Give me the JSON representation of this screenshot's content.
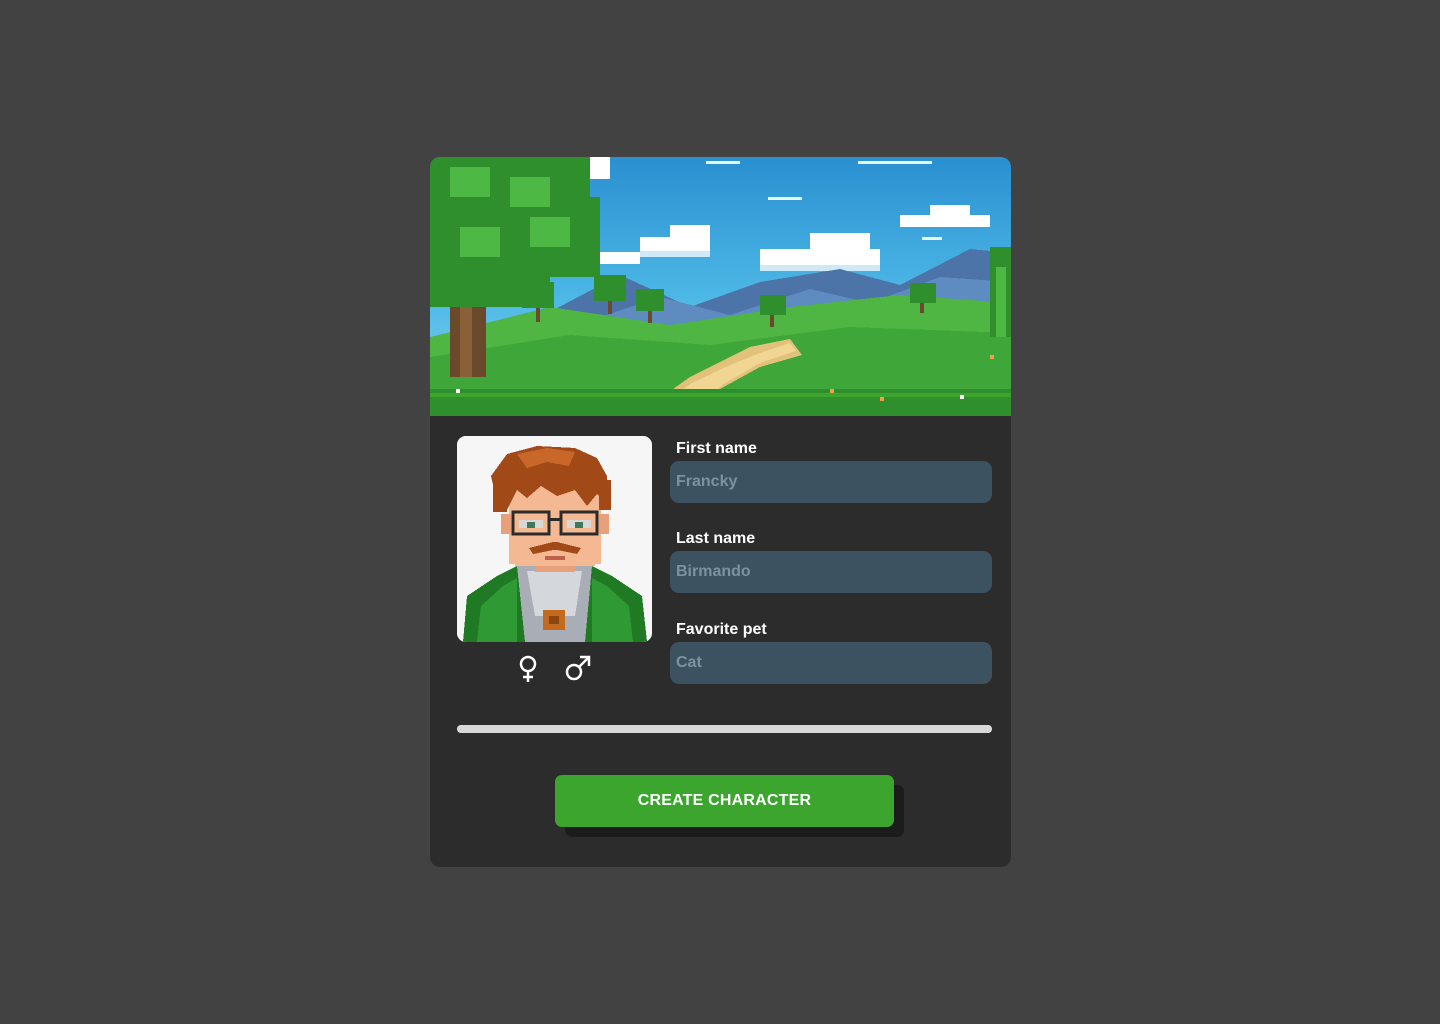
{
  "form": {
    "first_name": {
      "label": "First name",
      "placeholder": "Francky"
    },
    "last_name": {
      "label": "Last name",
      "placeholder": "Birmando"
    },
    "favorite_pet": {
      "label": "Favorite pet",
      "placeholder": "Cat"
    }
  },
  "gender_options": [
    "female-symbol-icon",
    "male-symbol-icon"
  ],
  "progress": {
    "fraction": 1.0
  },
  "create_button": {
    "label": "CREATE CHARACTER"
  },
  "colors": {
    "page_background": "#424242",
    "card_background": "#2c2c2c",
    "input_background": "#3c5261",
    "input_placeholder": "#7d92a0",
    "button_green": "#3ba52e",
    "progress": "#d8d8d8"
  }
}
